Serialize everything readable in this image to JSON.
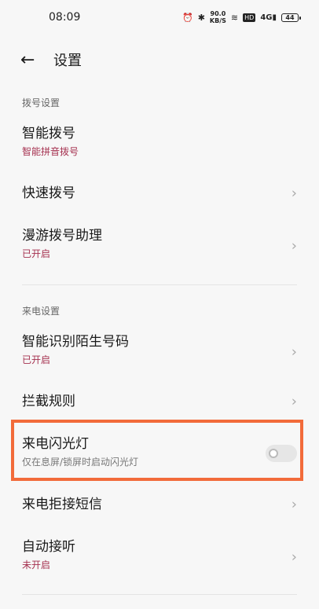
{
  "status": {
    "time": "08:09",
    "net_speed_value": "90.0",
    "net_speed_unit": "KB/S",
    "hd": "HD",
    "signal": "4G",
    "battery": "44"
  },
  "header": {
    "title": "设置"
  },
  "dial_section": {
    "title": "拨号设置",
    "items": [
      {
        "title": "智能拨号",
        "sub": "智能拼音拨号"
      },
      {
        "title": "快速拨号"
      },
      {
        "title": "漫游拨号助理",
        "sub": "已开启"
      }
    ]
  },
  "call_section": {
    "title": "来电设置",
    "items": [
      {
        "title": "智能识别陌生号码",
        "sub": "已开启"
      },
      {
        "title": "拦截规则"
      },
      {
        "title": "来电闪光灯",
        "sub": "仅在息屏/锁屏时启动闪光灯",
        "toggle_on": false
      },
      {
        "title": "来电拒接短信"
      },
      {
        "title": "自动接听",
        "sub": "未开启"
      }
    ]
  },
  "colors": {
    "accent": "#a5304f",
    "highlight": "#f26b3a"
  }
}
